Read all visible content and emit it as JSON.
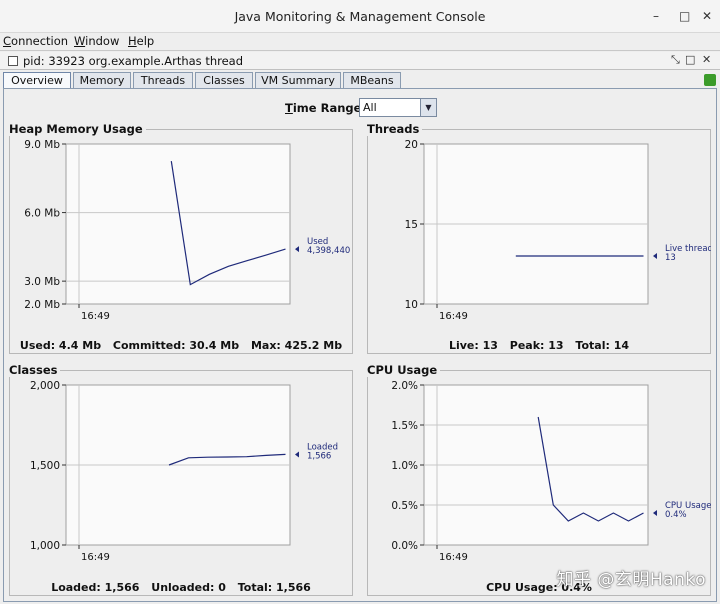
{
  "window": {
    "title": "Java Monitoring & Management Console",
    "minimize": "–",
    "maximize": "□",
    "close": "✕"
  },
  "menu": [
    "Connection",
    "Window",
    "Help"
  ],
  "document": {
    "title": "pid: 33923 org.example.Arthas thread"
  },
  "tabs": [
    "Overview",
    "Memory",
    "Threads",
    "Classes",
    "VM Summary",
    "MBeans"
  ],
  "active_tab": "Overview",
  "time_range": {
    "label": "Time Range:",
    "value": "All"
  },
  "colors": {
    "line": "#1f2a7a",
    "plot_bg": "#fafafa",
    "grid": "#c8c8c8"
  },
  "panels": {
    "heap": {
      "title": "Heap Memory Usage",
      "stats": [
        "Used: 4.4 Mb",
        "Committed: 30.4 Mb",
        "Max: 425.2 Mb"
      ]
    },
    "threads": {
      "title": "Threads",
      "stats": [
        "Live: 13",
        "Peak: 13",
        "Total: 14"
      ]
    },
    "classes": {
      "title": "Classes",
      "stats": [
        "Loaded: 1,566",
        "Unloaded: 0",
        "Total: 1,566"
      ]
    },
    "cpu": {
      "title": "CPU Usage",
      "stats": [
        "CPU Usage: 0.4%"
      ]
    }
  },
  "watermark": "知乎 @玄明Hanko",
  "chart_data": [
    {
      "id": "heap",
      "type": "line",
      "ylim": [
        2.0,
        9.0
      ],
      "yticks": [
        9.0,
        6.0,
        3.0,
        2.0
      ],
      "ytick_labels": [
        "9.0 Mb",
        "6.0 Mb",
        "3.0 Mb",
        "2.0 Mb"
      ],
      "xtick_labels": [
        "16:49"
      ],
      "x": [
        0,
        1,
        2,
        3,
        4,
        5,
        6
      ],
      "y": [
        8.25,
        2.85,
        3.3,
        3.65,
        3.9,
        4.15,
        4.4
      ],
      "series": [
        {
          "name": "Used",
          "value_label": "4,398,440"
        }
      ]
    },
    {
      "id": "threads",
      "type": "line",
      "ylim": [
        10,
        20
      ],
      "yticks": [
        20,
        15,
        10
      ],
      "ytick_labels": [
        "20",
        "15",
        "10"
      ],
      "xtick_labels": [
        "16:49"
      ],
      "x": [
        0,
        6
      ],
      "y": [
        13,
        13
      ],
      "series": [
        {
          "name": "Live threads",
          "value_label": "13"
        }
      ]
    },
    {
      "id": "classes",
      "type": "line",
      "ylim": [
        1000,
        2000
      ],
      "yticks": [
        2000,
        1500,
        1000
      ],
      "ytick_labels": [
        "2,000",
        "1,500",
        "1,000"
      ],
      "xtick_labels": [
        "16:49"
      ],
      "x": [
        0,
        1,
        2,
        3,
        4,
        5,
        6
      ],
      "y": [
        1500,
        1545,
        1549,
        1550,
        1552,
        1560,
        1566
      ],
      "series": [
        {
          "name": "Loaded",
          "value_label": "1,566"
        }
      ]
    },
    {
      "id": "cpu",
      "type": "line",
      "ylim": [
        0.0,
        2.0
      ],
      "yticks": [
        2.0,
        1.5,
        1.0,
        0.5,
        0.0
      ],
      "ytick_labels": [
        "2.0%",
        "1.5%",
        "1.0%",
        "0.5%",
        "0.0%"
      ],
      "xtick_labels": [
        "16:49"
      ],
      "x": [
        0,
        1,
        2,
        3,
        4,
        5,
        6,
        7
      ],
      "y": [
        1.6,
        0.5,
        0.3,
        0.4,
        0.3,
        0.4,
        0.3,
        0.4
      ],
      "series": [
        {
          "name": "CPU Usage",
          "value_label": "0.4%"
        }
      ]
    }
  ]
}
